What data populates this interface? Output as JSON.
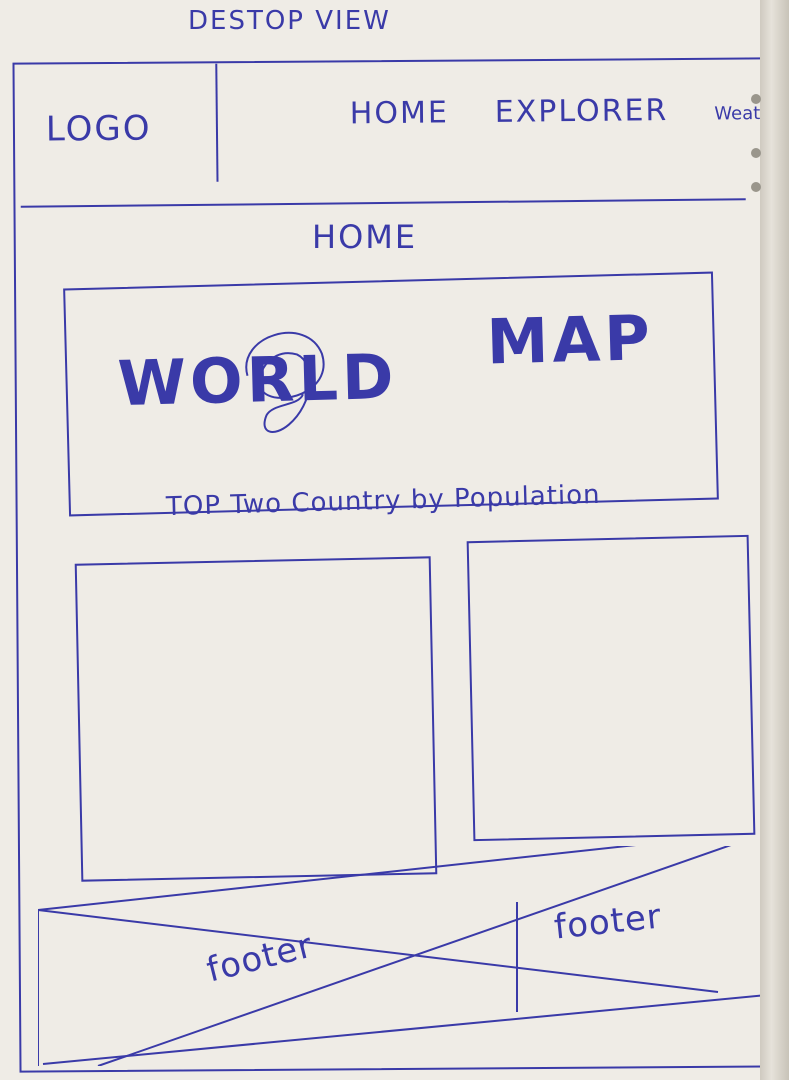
{
  "view_title": "DESTOP VIEW",
  "header": {
    "logo": "LOGO",
    "nav": [
      {
        "label": "HOME"
      },
      {
        "label": "EXPLORER"
      },
      {
        "label": "Weather"
      }
    ]
  },
  "main": {
    "page_heading": "HOME",
    "hero": {
      "word_left": "WORLD",
      "word_right": "MAP"
    },
    "section_title": "TOP Two Country by Population",
    "cards": [
      {
        "id": "card-1"
      },
      {
        "id": "card-2"
      }
    ]
  },
  "footer": {
    "left_label": "footer",
    "right_label": "footer"
  },
  "colors": {
    "ink": "#3a3aa8",
    "paper": "#efece6"
  }
}
